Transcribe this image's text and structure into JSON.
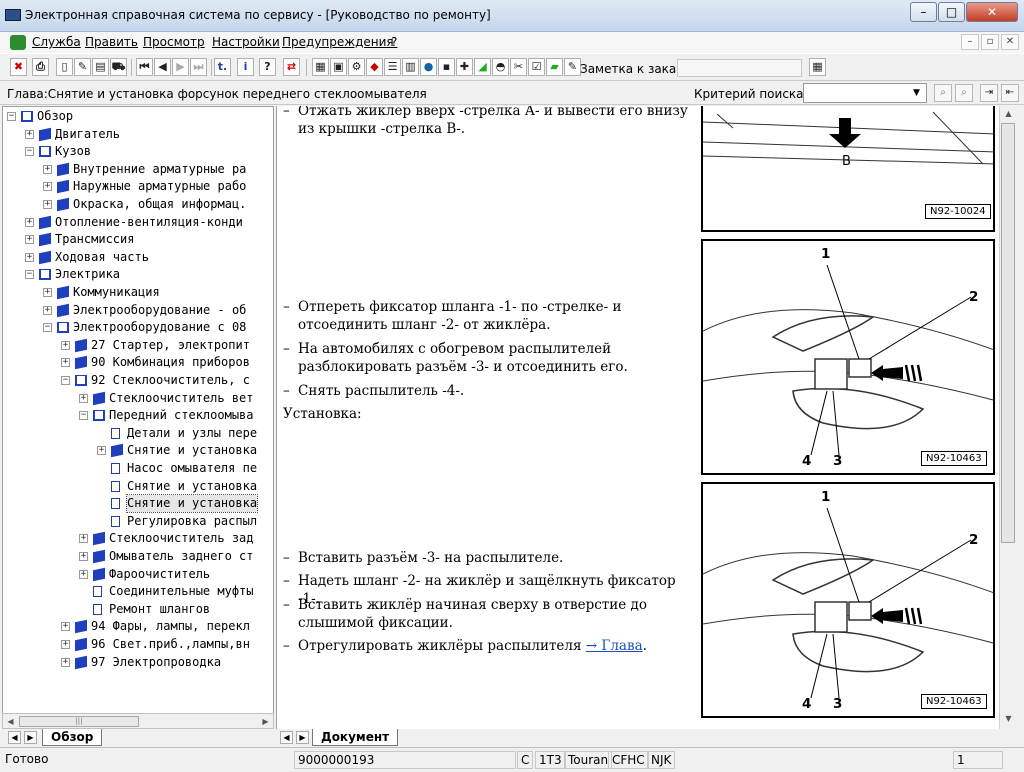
{
  "window": {
    "title": "Электронная справочная система по сервису - [Руководство по ремонту]"
  },
  "menu": {
    "items": [
      "Служба",
      "Править",
      "Просмотр",
      "Настройки",
      "Предупреждения",
      "?"
    ]
  },
  "toolbar": {
    "order_label": "Заметка к заказу:",
    "order_value": ""
  },
  "chapter": {
    "text": "Глава:Снятие и установка форсунок переднего стеклоомывателя",
    "criteria_label": "Критерий поиска:",
    "search_value": ""
  },
  "tree": {
    "items": [
      {
        "label": "Обзор",
        "level": 0,
        "exp": "minus",
        "icon": "open-book"
      },
      {
        "label": "Двигатель",
        "level": 1,
        "exp": "plus",
        "icon": "book"
      },
      {
        "label": "Кузов",
        "level": 1,
        "exp": "minus",
        "icon": "open-book"
      },
      {
        "label": "Внутренние арматурные ра",
        "level": 2,
        "exp": "plus",
        "icon": "book"
      },
      {
        "label": "Наружные арматурные рабо",
        "level": 2,
        "exp": "plus",
        "icon": "book"
      },
      {
        "label": "Окраска, общая информац.",
        "level": 2,
        "exp": "plus",
        "icon": "book"
      },
      {
        "label": "Отопление-вентиляция-конди",
        "level": 1,
        "exp": "plus",
        "icon": "book"
      },
      {
        "label": "Трансмиссия",
        "level": 1,
        "exp": "plus",
        "icon": "book"
      },
      {
        "label": "Ходовая часть",
        "level": 1,
        "exp": "plus",
        "icon": "book"
      },
      {
        "label": "Электрика",
        "level": 1,
        "exp": "minus",
        "icon": "open-book"
      },
      {
        "label": "Коммуникация",
        "level": 2,
        "exp": "plus",
        "icon": "book"
      },
      {
        "label": "Электрооборудование - об",
        "level": 2,
        "exp": "plus",
        "icon": "book"
      },
      {
        "label": "Электрооборудование с 08",
        "level": 2,
        "exp": "minus",
        "icon": "open-book"
      },
      {
        "label": "27 Стартер, электропит",
        "level": 3,
        "exp": "plus",
        "icon": "book"
      },
      {
        "label": "90 Комбинация приборов",
        "level": 3,
        "exp": "plus",
        "icon": "book"
      },
      {
        "label": "92 Стеклоочиститель, с",
        "level": 3,
        "exp": "minus",
        "icon": "open-book"
      },
      {
        "label": "Стеклоочиститель вет",
        "level": 4,
        "exp": "plus",
        "icon": "book"
      },
      {
        "label": "Передний стеклоомыва",
        "level": 4,
        "exp": "minus",
        "icon": "open-book"
      },
      {
        "label": "Детали и узлы пере",
        "level": 5,
        "exp": "none",
        "icon": "page"
      },
      {
        "label": "Снятие и установка",
        "level": 5,
        "exp": "plus",
        "icon": "book"
      },
      {
        "label": "Насос омывателя пе",
        "level": 5,
        "exp": "none",
        "icon": "page"
      },
      {
        "label": "Снятие и установка",
        "level": 5,
        "exp": "none",
        "icon": "page"
      },
      {
        "label": "Снятие и установка",
        "level": 5,
        "exp": "none",
        "icon": "page",
        "selected": true
      },
      {
        "label": "Регулировка распыл",
        "level": 5,
        "exp": "none",
        "icon": "page"
      },
      {
        "label": "Стеклоочиститель зад",
        "level": 4,
        "exp": "plus",
        "icon": "book"
      },
      {
        "label": "Омыватель заднего ст",
        "level": 4,
        "exp": "plus",
        "icon": "book"
      },
      {
        "label": "Фароочиститель",
        "level": 4,
        "exp": "plus",
        "icon": "book"
      },
      {
        "label": "Соединительные муфты",
        "level": 4,
        "exp": "none",
        "icon": "page"
      },
      {
        "label": "Ремонт шлангов",
        "level": 4,
        "exp": "none",
        "icon": "page"
      },
      {
        "label": "94 Фары, лампы, перекл",
        "level": 3,
        "exp": "plus",
        "icon": "book"
      },
      {
        "label": "96 Свет.приб.,лампы,вн",
        "level": 3,
        "exp": "plus",
        "icon": "book"
      },
      {
        "label": "97 Электропроводка",
        "level": 3,
        "exp": "plus",
        "icon": "book"
      }
    ]
  },
  "tabs": {
    "left": "Обзор",
    "right": "Документ"
  },
  "document": {
    "p1": "Отжать жиклер вверх -стрелка А- и вывести его внизу из крышки -стрелка В-.",
    "p2": "Отпереть фиксатор шланга -1- по -стрелке- и отсоединить шланг -2- от жиклёра.",
    "p3": "На автомобилях с обогревом распылителей разблокировать разъём -3- и отсоединить его.",
    "p4": "Снять распылитель -4-.",
    "section": "Установка:",
    "p5": "Вставить разъём -3- на распылителе.",
    "p6": "Надеть шланг -2- на жиклёр и защёлкнуть фиксатор -1-.",
    "p7": "Вставить жиклёр начиная сверху в отверстие до слышимой фиксации.",
    "p8_text": "Отрегулировать жиклёры распылителя",
    "p8_link": "→ Глава",
    "p8_end": ".",
    "dash": "–"
  },
  "figures": {
    "fig1": {
      "label": "N92-10024",
      "letter": "B"
    },
    "fig2": {
      "label": "N92-10463",
      "n1": "1",
      "n2": "2",
      "n3": "3",
      "n4": "4"
    },
    "fig3": {
      "label": "N92-10463",
      "n1": "1",
      "n2": "2",
      "n3": "3",
      "n4": "4"
    }
  },
  "status": {
    "ready": "Готово",
    "code": "9000000193",
    "c": "C",
    "engine": "1T3",
    "model": "Touran",
    "code2": "CFHC",
    "code3": "NJK",
    "page": "1"
  }
}
